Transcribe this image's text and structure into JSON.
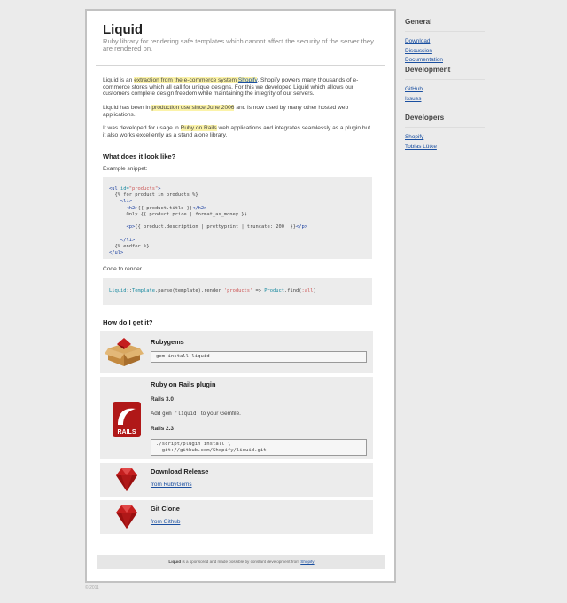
{
  "header": {
    "title": "Liquid",
    "subtitle": "Ruby library for rendering safe templates which cannot affect the security of the server they are rendered on."
  },
  "intro": {
    "p1_before": "Liquid is an ",
    "p1_hl": "extraction from the e-commerce system ",
    "p1_link": "Shopify",
    "p1_after": ". Shopify powers many thousands of e-commerce stores which all call for unique designs. For this we developed Liquid which allows our customers complete design freedom while maintaining the integrity of our servers.",
    "p2_before": "Liquid has been in ",
    "p2_hl": "production use since June 2006",
    "p2_after": " and is now used by many other hosted web applications.",
    "p3_before": "It was developed for usage in ",
    "p3_hl": "Ruby on Rails",
    "p3_after": " web applications and integrates seamlessly as a plugin but it also works excellently as a stand alone library."
  },
  "look": {
    "heading": "What does it look like?",
    "example_label": "Example snippet:",
    "render_label": "Code to render"
  },
  "get": {
    "heading": "How do I get it?",
    "rubygems": {
      "title": "Rubygems",
      "cmd": "gem install liquid"
    },
    "rails": {
      "title": "Ruby on Rails plugin",
      "v30": "Rails 3.0",
      "v30_text_before": "Add ",
      "v30_code": "gem 'liquid'",
      "v30_text_after": " to your Gemfile.",
      "v23": "Rails 2.3",
      "v23_cmd": "./script/plugin install \\\n  git://github.com/Shopify/liquid.git"
    },
    "download": {
      "title": "Download Release",
      "link": "from RubyGems"
    },
    "git": {
      "title": "Git Clone",
      "link": "from Github"
    }
  },
  "footer": {
    "brand": "Liquid",
    "text": " is a sponsored and made possible by constant development from ",
    "link": "Shopify"
  },
  "copyright": "© 2011",
  "sidebar": {
    "sections": [
      {
        "heading": "General",
        "links": [
          "Download",
          "Discussion",
          "Documentation"
        ]
      },
      {
        "heading": "Development",
        "links": [
          "GitHub",
          "Issues"
        ]
      },
      {
        "heading": "Developers",
        "links": [
          "Shopify",
          "Tobias Lütke"
        ]
      }
    ]
  },
  "colors": {
    "highlight": "#fbf3a9",
    "link": "#1a4fa0",
    "ruby_red": "#b01818"
  },
  "icons": {
    "rubygems": "cardboard-box-with-gem-icon",
    "rails": "rails-logo-icon",
    "download": "ruby-gem-icon",
    "git": "ruby-gem-icon"
  }
}
